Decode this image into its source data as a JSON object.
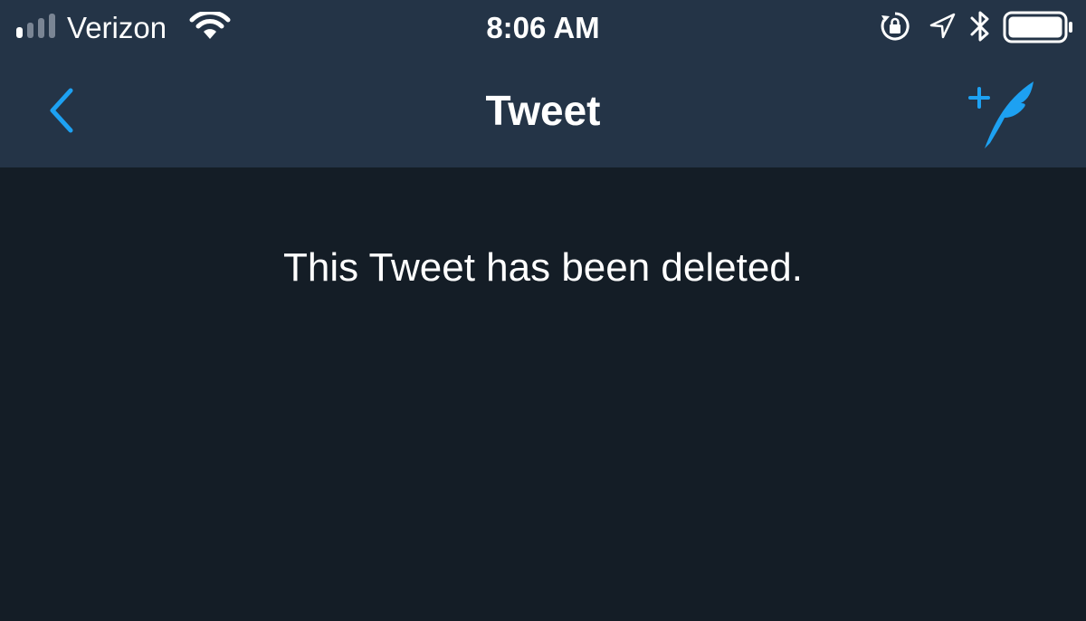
{
  "status_bar": {
    "carrier": "Verizon",
    "time": "8:06 AM",
    "signal_icon": "signal-bars-icon",
    "wifi_icon": "wifi-icon",
    "rotation_icon": "rotation-lock-icon",
    "location_icon": "location-arrow-icon",
    "bluetooth_icon": "bluetooth-icon",
    "battery_icon": "battery-icon",
    "signal_bars_filled": 1,
    "signal_bars_total": 4,
    "battery_level": 1.0
  },
  "nav": {
    "title": "Tweet",
    "back_icon": "chevron-left-icon",
    "compose_icon": "compose-tweet-icon"
  },
  "content": {
    "message": "This Tweet has been deleted."
  },
  "colors": {
    "header_bg": "#243447",
    "body_bg": "#141d26",
    "accent": "#1da1f2",
    "text": "#ffffff"
  }
}
